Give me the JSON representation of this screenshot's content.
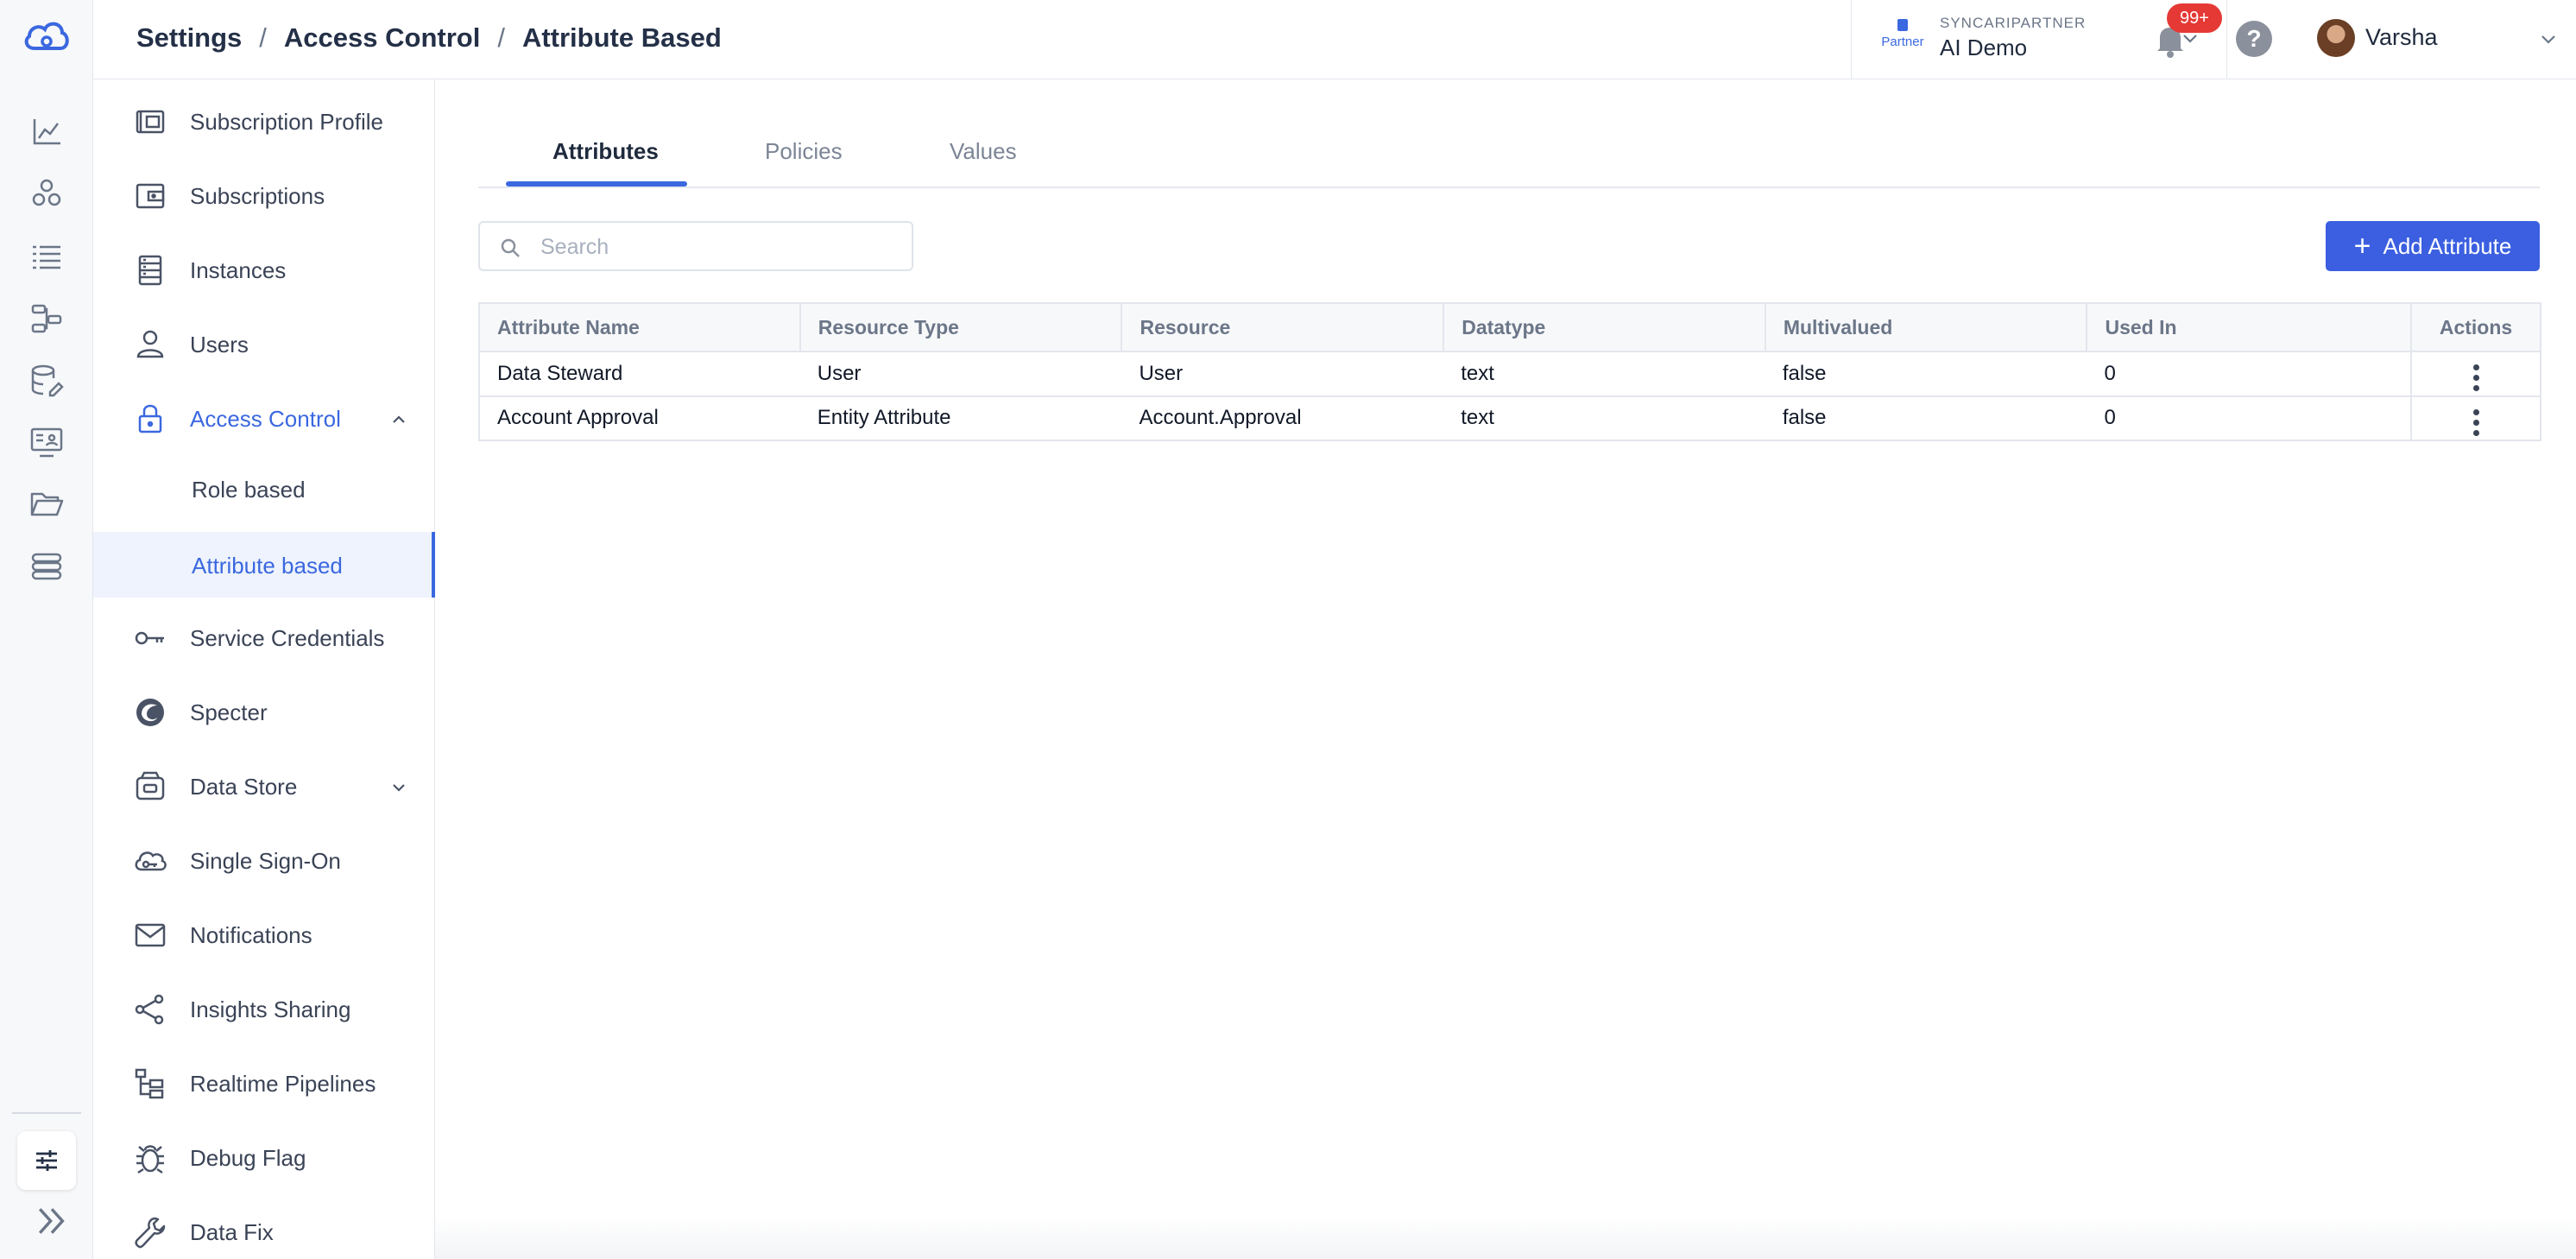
{
  "header": {
    "breadcrumb": [
      "Settings",
      "Access Control",
      "Attribute Based"
    ],
    "separator": "/",
    "org": {
      "badge": "Partner",
      "label": "SYNCARIPARTNER",
      "name": "AI Demo"
    },
    "notifications_count": "99+",
    "help": "?",
    "user_name": "Varsha"
  },
  "rail": {
    "icons": [
      "dashboard-chart-icon",
      "entities-icon",
      "list-icon",
      "pipelines-icon",
      "datastore-edit-icon",
      "monitor-user-icon",
      "folder-icon",
      "stack-icon",
      "settings-sliders-icon",
      "expand-icon"
    ]
  },
  "sidebar": {
    "items": [
      {
        "label": "Subscription Profile",
        "icon": "subscription-profile-icon"
      },
      {
        "label": "Subscriptions",
        "icon": "wallet-icon"
      },
      {
        "label": "Instances",
        "icon": "server-icon"
      },
      {
        "label": "Users",
        "icon": "user-icon"
      },
      {
        "label": "Access Control",
        "icon": "lock-icon"
      },
      {
        "label": "Service Credentials",
        "icon": "key-icon"
      },
      {
        "label": "Specter",
        "icon": "specter-icon"
      },
      {
        "label": "Data Store",
        "icon": "datastore-icon"
      },
      {
        "label": "Single Sign-On",
        "icon": "cloud-key-icon"
      },
      {
        "label": "Notifications",
        "icon": "mail-icon"
      },
      {
        "label": "Insights Sharing",
        "icon": "share-icon"
      },
      {
        "label": "Realtime Pipelines",
        "icon": "tree-icon"
      },
      {
        "label": "Debug Flag",
        "icon": "bug-icon"
      },
      {
        "label": "Data Fix",
        "icon": "wrench-icon"
      }
    ],
    "access_control_sub": [
      "Role based",
      "Attribute based"
    ]
  },
  "tabs": [
    "Attributes",
    "Policies",
    "Values"
  ],
  "active_tab": "Attributes",
  "search": {
    "placeholder": "Search",
    "value": ""
  },
  "add_button": "Add Attribute",
  "table": {
    "columns": [
      "Attribute Name",
      "Resource Type",
      "Resource",
      "Datatype",
      "Multivalued",
      "Used In",
      "Actions"
    ],
    "rows": [
      [
        "Data Steward",
        "User",
        "User",
        "text",
        "false",
        "0"
      ],
      [
        "Account Approval",
        "Entity Attribute",
        "Account.Approval",
        "text",
        "false",
        "0"
      ]
    ]
  },
  "colors": {
    "accent": "#3b68e0",
    "button": "#3b5fe0",
    "badge": "#e53935"
  }
}
